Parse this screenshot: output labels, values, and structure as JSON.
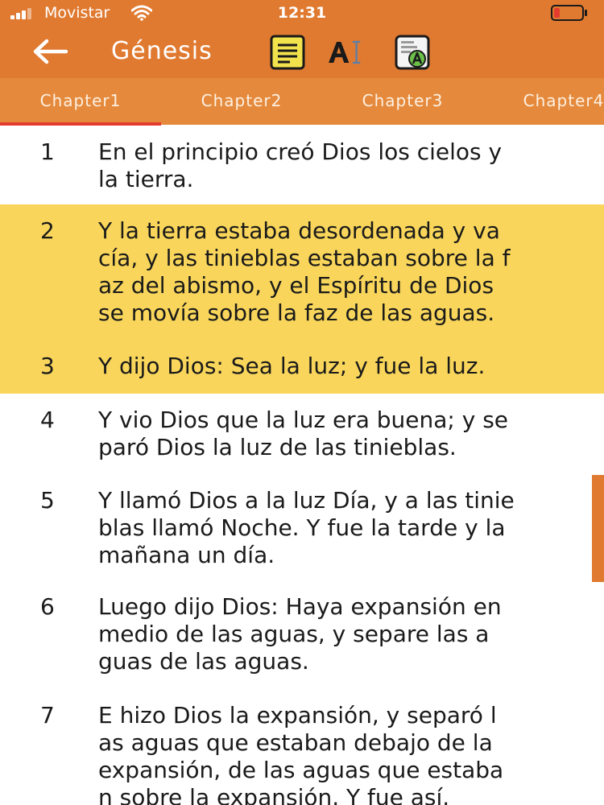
{
  "status_bar": {
    "carrier": "Movistar",
    "time": "12:31",
    "signal_bars": 3,
    "battery_level": 0.2
  },
  "nav": {
    "title": "Génesis",
    "back_icon": "arrow-left-icon",
    "tools": [
      "notes-icon",
      "font-size-icon",
      "translate-icon"
    ]
  },
  "tabs": {
    "items": [
      "Chapter1",
      "Chapter2",
      "Chapter3",
      "Chapter4"
    ],
    "selected": "Chapter1"
  },
  "verses": [
    {
      "num": "1",
      "text": "En el principio creó Dios los cielos y\n la tierra.",
      "highlighted": false
    },
    {
      "num": "2",
      "text": "Y la tierra estaba desordenada y va\ncía, y las tinieblas estaban sobre la f\naz del abismo, y el Espíritu de Dios\nse movía sobre la faz de las aguas.",
      "highlighted": true
    },
    {
      "num": "3",
      "text": "Y dijo Dios: Sea la luz; y fue la luz.",
      "highlighted": true
    },
    {
      "num": "4",
      "text": "Y vio Dios que la luz era buena; y se\nparó Dios la luz de las tinieblas.",
      "highlighted": false
    },
    {
      "num": "5",
      "text": "Y llamó Dios a la luz Día, y a las tinie\nblas llamó Noche. Y fue la tarde y la\n mañana un día.",
      "highlighted": false
    },
    {
      "num": "6",
      "text": "Luego dijo Dios: Haya expansión en\n medio de las aguas, y separe las a\nguas de las aguas.",
      "highlighted": false
    },
    {
      "num": "7",
      "text": "E hizo Dios la expansión, y separó l\nas aguas que estaban debajo de la\nexpansión, de las aguas que estaba\nn sobre la expansión. Y fue así.",
      "highlighted": false
    }
  ],
  "colors": {
    "header": "#e07a30",
    "tabs_bar": "#e58a3c",
    "tab_indicator": "#e43b2f",
    "highlight": "#f9d65b"
  }
}
